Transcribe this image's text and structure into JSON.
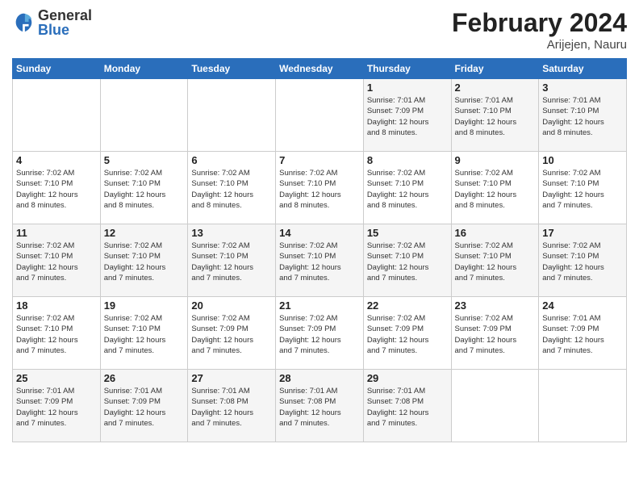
{
  "header": {
    "logo_general": "General",
    "logo_blue": "Blue",
    "month_year": "February 2024",
    "location": "Arijejen, Nauru"
  },
  "days_of_week": [
    "Sunday",
    "Monday",
    "Tuesday",
    "Wednesday",
    "Thursday",
    "Friday",
    "Saturday"
  ],
  "weeks": [
    [
      {
        "day": "",
        "info": ""
      },
      {
        "day": "",
        "info": ""
      },
      {
        "day": "",
        "info": ""
      },
      {
        "day": "",
        "info": ""
      },
      {
        "day": "1",
        "info": "Sunrise: 7:01 AM\nSunset: 7:09 PM\nDaylight: 12 hours\nand 8 minutes."
      },
      {
        "day": "2",
        "info": "Sunrise: 7:01 AM\nSunset: 7:10 PM\nDaylight: 12 hours\nand 8 minutes."
      },
      {
        "day": "3",
        "info": "Sunrise: 7:01 AM\nSunset: 7:10 PM\nDaylight: 12 hours\nand 8 minutes."
      }
    ],
    [
      {
        "day": "4",
        "info": "Sunrise: 7:02 AM\nSunset: 7:10 PM\nDaylight: 12 hours\nand 8 minutes."
      },
      {
        "day": "5",
        "info": "Sunrise: 7:02 AM\nSunset: 7:10 PM\nDaylight: 12 hours\nand 8 minutes."
      },
      {
        "day": "6",
        "info": "Sunrise: 7:02 AM\nSunset: 7:10 PM\nDaylight: 12 hours\nand 8 minutes."
      },
      {
        "day": "7",
        "info": "Sunrise: 7:02 AM\nSunset: 7:10 PM\nDaylight: 12 hours\nand 8 minutes."
      },
      {
        "day": "8",
        "info": "Sunrise: 7:02 AM\nSunset: 7:10 PM\nDaylight: 12 hours\nand 8 minutes."
      },
      {
        "day": "9",
        "info": "Sunrise: 7:02 AM\nSunset: 7:10 PM\nDaylight: 12 hours\nand 8 minutes."
      },
      {
        "day": "10",
        "info": "Sunrise: 7:02 AM\nSunset: 7:10 PM\nDaylight: 12 hours\nand 7 minutes."
      }
    ],
    [
      {
        "day": "11",
        "info": "Sunrise: 7:02 AM\nSunset: 7:10 PM\nDaylight: 12 hours\nand 7 minutes."
      },
      {
        "day": "12",
        "info": "Sunrise: 7:02 AM\nSunset: 7:10 PM\nDaylight: 12 hours\nand 7 minutes."
      },
      {
        "day": "13",
        "info": "Sunrise: 7:02 AM\nSunset: 7:10 PM\nDaylight: 12 hours\nand 7 minutes."
      },
      {
        "day": "14",
        "info": "Sunrise: 7:02 AM\nSunset: 7:10 PM\nDaylight: 12 hours\nand 7 minutes."
      },
      {
        "day": "15",
        "info": "Sunrise: 7:02 AM\nSunset: 7:10 PM\nDaylight: 12 hours\nand 7 minutes."
      },
      {
        "day": "16",
        "info": "Sunrise: 7:02 AM\nSunset: 7:10 PM\nDaylight: 12 hours\nand 7 minutes."
      },
      {
        "day": "17",
        "info": "Sunrise: 7:02 AM\nSunset: 7:10 PM\nDaylight: 12 hours\nand 7 minutes."
      }
    ],
    [
      {
        "day": "18",
        "info": "Sunrise: 7:02 AM\nSunset: 7:10 PM\nDaylight: 12 hours\nand 7 minutes."
      },
      {
        "day": "19",
        "info": "Sunrise: 7:02 AM\nSunset: 7:10 PM\nDaylight: 12 hours\nand 7 minutes."
      },
      {
        "day": "20",
        "info": "Sunrise: 7:02 AM\nSunset: 7:09 PM\nDaylight: 12 hours\nand 7 minutes."
      },
      {
        "day": "21",
        "info": "Sunrise: 7:02 AM\nSunset: 7:09 PM\nDaylight: 12 hours\nand 7 minutes."
      },
      {
        "day": "22",
        "info": "Sunrise: 7:02 AM\nSunset: 7:09 PM\nDaylight: 12 hours\nand 7 minutes."
      },
      {
        "day": "23",
        "info": "Sunrise: 7:02 AM\nSunset: 7:09 PM\nDaylight: 12 hours\nand 7 minutes."
      },
      {
        "day": "24",
        "info": "Sunrise: 7:01 AM\nSunset: 7:09 PM\nDaylight: 12 hours\nand 7 minutes."
      }
    ],
    [
      {
        "day": "25",
        "info": "Sunrise: 7:01 AM\nSunset: 7:09 PM\nDaylight: 12 hours\nand 7 minutes."
      },
      {
        "day": "26",
        "info": "Sunrise: 7:01 AM\nSunset: 7:09 PM\nDaylight: 12 hours\nand 7 minutes."
      },
      {
        "day": "27",
        "info": "Sunrise: 7:01 AM\nSunset: 7:08 PM\nDaylight: 12 hours\nand 7 minutes."
      },
      {
        "day": "28",
        "info": "Sunrise: 7:01 AM\nSunset: 7:08 PM\nDaylight: 12 hours\nand 7 minutes."
      },
      {
        "day": "29",
        "info": "Sunrise: 7:01 AM\nSunset: 7:08 PM\nDaylight: 12 hours\nand 7 minutes."
      },
      {
        "day": "",
        "info": ""
      },
      {
        "day": "",
        "info": ""
      }
    ]
  ]
}
